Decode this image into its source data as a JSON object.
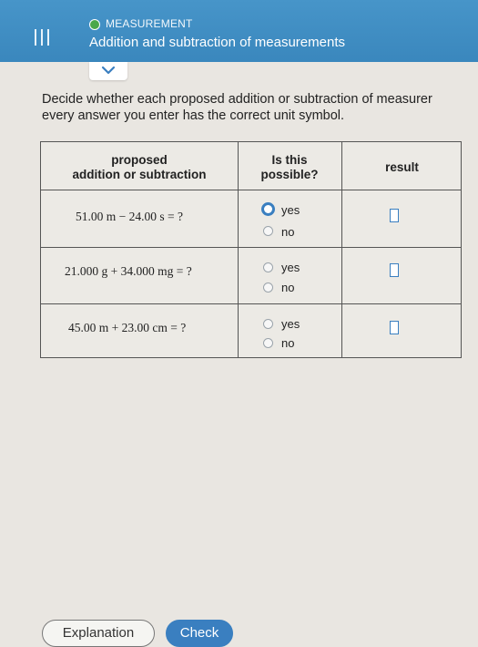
{
  "header": {
    "topic": "MEASUREMENT",
    "title": "Addition and subtraction of measurements",
    "topic_color": "#4aa84a",
    "bar_color": "#3f8fc4"
  },
  "instructions": {
    "line1": "Decide whether each proposed addition or subtraction of measurer",
    "line2": "every answer you enter has the correct unit symbol."
  },
  "table": {
    "col1_head_line1": "proposed",
    "col1_head_line2": "addition or subtraction",
    "col2_head_line1": "Is this",
    "col2_head_line2": "possible?",
    "col3_head": "result",
    "rows": [
      {
        "expression": "51.00 m  −  24.00 s  =  ?",
        "yes": "yes",
        "no": "no",
        "selected": "yes"
      },
      {
        "expression": "21.000 g  +  34.000 mg  =  ?",
        "yes": "yes",
        "no": "no",
        "selected": ""
      },
      {
        "expression": "45.00 m  +  23.00 cm  =  ?",
        "yes": "yes",
        "no": "no",
        "selected": ""
      }
    ]
  },
  "buttons": {
    "explanation": "Explanation",
    "check": "Check"
  },
  "colors": {
    "accent": "#3a7fc0"
  }
}
